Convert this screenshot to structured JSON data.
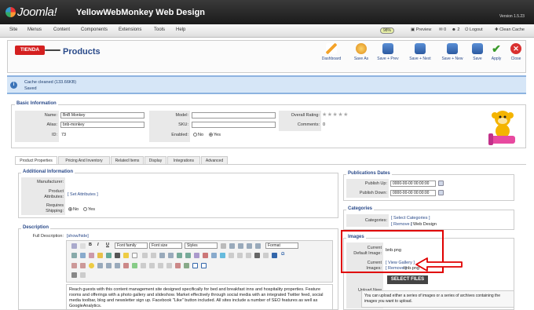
{
  "header": {
    "logo_text": "Joomla!",
    "site_name": "YellowWebMonkey Web Design",
    "version": "Version 1.5.23"
  },
  "menu": {
    "items": [
      "Site",
      "Menus",
      "Content",
      "Components",
      "Extensions",
      "Tools",
      "Help"
    ]
  },
  "status": {
    "badge": "98%",
    "preview": "Preview",
    "messages": "0",
    "users": "2",
    "online": "0",
    "logout": "Logout",
    "clean_cache": "Clean Cache"
  },
  "toolbar": {
    "brand": "TIENDA",
    "title": "Products",
    "buttons": [
      "Dashboard",
      "Save As",
      "Save + Prev",
      "Save + Next",
      "Save + New",
      "Save",
      "Apply",
      "Close"
    ]
  },
  "message": {
    "line1": "Cache cleaned (133.66KB)",
    "line2": "Saved"
  },
  "basic": {
    "legend": "Basic Information",
    "name_label": "Name:",
    "name_value": "BnB Monkey",
    "alias_label": "Alias:",
    "alias_value": "bnb-monkey",
    "id_label": "ID:",
    "id_value": "73",
    "model_label": "Model:",
    "sku_label": "SKU:",
    "enabled_label": "Enabled:",
    "no": "No",
    "yes": "Yes",
    "rating_label": "Overall Rating:",
    "comments_label": "Comments:",
    "comments_value": "0"
  },
  "tabs": [
    "Product Properties",
    "Pricing And Inventory",
    "Related Items",
    "Display",
    "Integrations",
    "Advanced"
  ],
  "additional": {
    "legend": "Additional Information",
    "manufacturer_label": "Manufacturer:",
    "attributes_label_1": "Product",
    "attributes_label_2": "Attributes:",
    "attributes_link": "[ Set Attributes ]",
    "shipping_label_1": "Requires",
    "shipping_label_2": "Shipping:",
    "no": "No",
    "yes": "Yes"
  },
  "description": {
    "legend": "Description",
    "full_label": "Full Description:",
    "toggle": "[show/hide]",
    "font_family": "Font family",
    "font_size": "Font size",
    "styles": "Styles",
    "format": "Format",
    "text": "Reach guests with this content management site designed specifically for bed and breakfast inns and hospitality properties.  Feature rooms and offerings with a photo gallery and slideshow.  Market effectively through social media with an integrated Twitter feed, social media toolbar, blog and newsletter sign up.  Facebook \"Like\" button included. All sites include a number of SEO features as well as GoogleAnalytics."
  },
  "publications": {
    "legend": "Publications Dates",
    "up_label": "Publish Up:",
    "up_value": "0000-00-00 00:00:00",
    "down_label": "Publish Down:",
    "down_value": "0000-00-00 00:00:00"
  },
  "categories": {
    "legend": "Categories",
    "label": "Categories:",
    "select": "[ Select Categories ]",
    "remove": "[ Remove ]",
    "value": "/ Web Design"
  },
  "images": {
    "legend": "Images",
    "default_label_1": "Current",
    "default_label_2": "Default Image:",
    "default_value": "bnb.png",
    "current_label_1": "Current",
    "current_label_2": "Images:",
    "view_gallery": "[ View Gallery ]",
    "remove": "[ Remove ]",
    "current_value": "bnb.png",
    "select_files": "SELECT FILES",
    "upload_label_1": "Upload New",
    "upload_label_2": "Image:",
    "upload_text": "You can upload either a series of images or a series of archives containing the images you want to upload."
  },
  "colors": {
    "accent": "#2a4a8a",
    "annotation": "#e00000",
    "brand": "#d42020"
  }
}
